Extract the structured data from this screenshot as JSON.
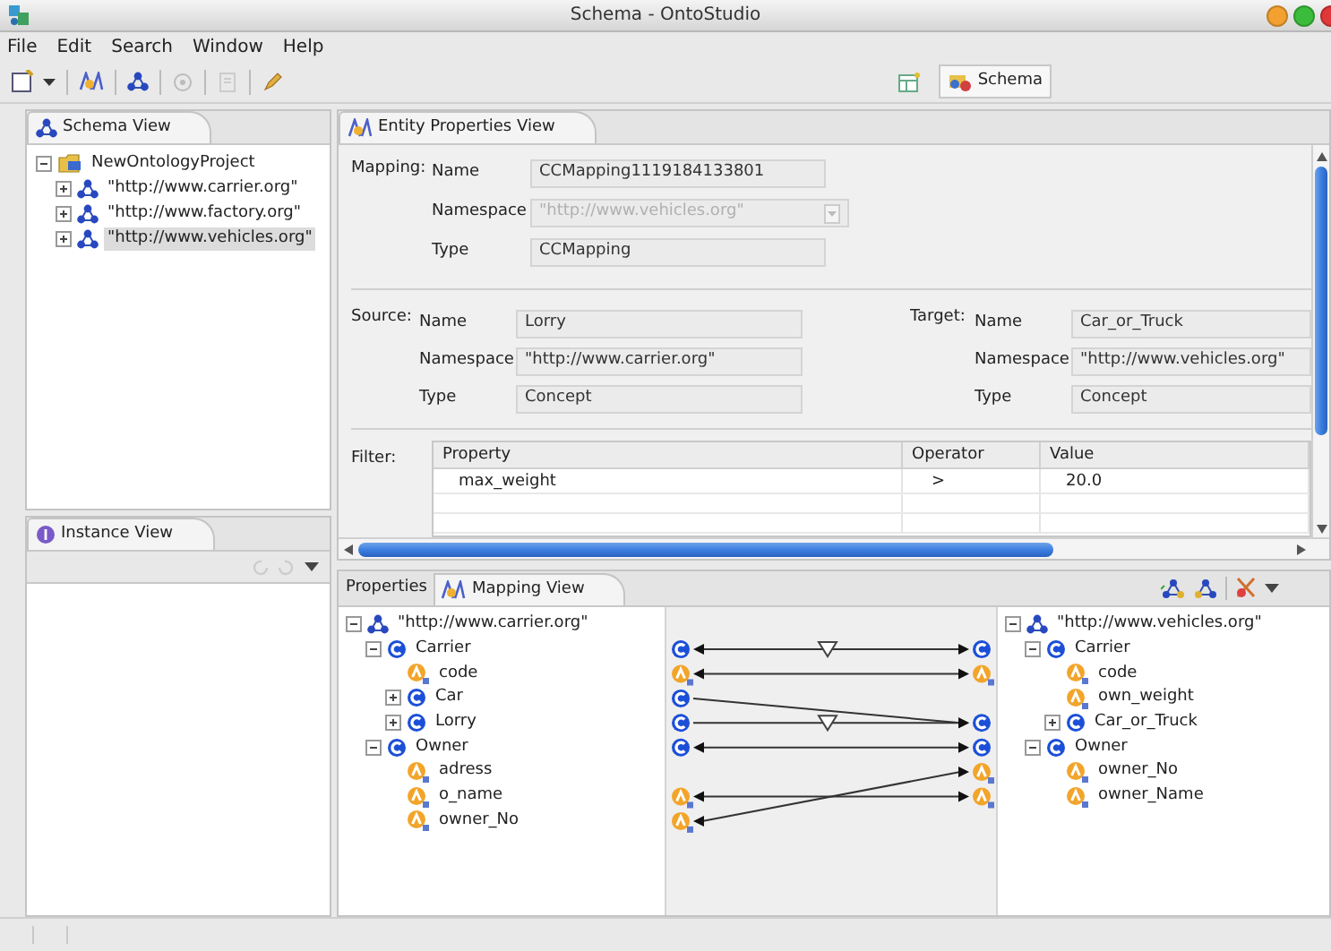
{
  "window": {
    "title": "Schema - OntoStudio"
  },
  "menu": [
    "File",
    "Edit",
    "Search",
    "Window",
    "Help"
  ],
  "perspectives": [
    {
      "label": "Schema",
      "selected": true
    }
  ],
  "schema_view": {
    "title": "Schema View",
    "tree": [
      {
        "label": "NewOntologyProject",
        "kind": "project",
        "expanded": true,
        "selected": false,
        "children": [
          {
            "label": "\"http://www.carrier.org\"",
            "kind": "namespace",
            "expanded": false,
            "selected": false
          },
          {
            "label": "\"http://www.factory.org\"",
            "kind": "namespace",
            "expanded": false,
            "selected": false
          },
          {
            "label": "\"http://www.vehicles.org\"",
            "kind": "namespace",
            "expanded": false,
            "selected": true
          }
        ]
      }
    ]
  },
  "instance_view": {
    "title": "Instance View"
  },
  "entity_properties": {
    "title": "Entity Properties View",
    "mapping": {
      "label": "Mapping:",
      "fields": [
        {
          "label": "Name",
          "value": "CCMapping1119184133801",
          "kind": "text",
          "disabled": false
        },
        {
          "label": "Namespace",
          "value": "\"http://www.vehicles.org\"",
          "kind": "combo",
          "disabled": true
        },
        {
          "label": "Type",
          "value": "CCMapping",
          "kind": "text",
          "disabled": false
        }
      ]
    },
    "source": {
      "label": "Source:",
      "fields": [
        {
          "label": "Name",
          "value": "Lorry"
        },
        {
          "label": "Namespace",
          "value": "\"http://www.carrier.org\""
        },
        {
          "label": "Type",
          "value": "Concept"
        }
      ]
    },
    "target": {
      "label": "Target:",
      "fields": [
        {
          "label": "Name",
          "value": "Car_or_Truck"
        },
        {
          "label": "Namespace",
          "value": "\"http://www.vehicles.org\""
        },
        {
          "label": "Type",
          "value": "Concept"
        }
      ]
    },
    "filter": {
      "label": "Filter:",
      "columns": [
        "Property",
        "Operator",
        "Value"
      ],
      "rows": [
        [
          "max_weight",
          ">",
          "20.0"
        ]
      ]
    }
  },
  "mapping_view": {
    "tabs": [
      {
        "label": "Properties",
        "selected": false
      },
      {
        "label": "Mapping View",
        "selected": true
      }
    ],
    "source_tree": [
      {
        "label": "\"http://www.carrier.org\"",
        "kind": "namespace",
        "expanded": true,
        "children": [
          {
            "label": "Carrier",
            "kind": "concept",
            "expanded": true,
            "children": [
              {
                "label": "code",
                "kind": "attribute"
              },
              {
                "label": "Car",
                "kind": "concept",
                "expanded": false
              },
              {
                "label": "Lorry",
                "kind": "concept",
                "expanded": false
              }
            ]
          },
          {
            "label": "Owner",
            "kind": "concept",
            "expanded": true,
            "children": [
              {
                "label": "adress",
                "kind": "attribute"
              },
              {
                "label": "o_name",
                "kind": "attribute"
              },
              {
                "label": "owner_No",
                "kind": "attribute"
              }
            ]
          }
        ]
      }
    ],
    "target_tree": [
      {
        "label": "\"http://www.vehicles.org\"",
        "kind": "namespace",
        "expanded": true,
        "children": [
          {
            "label": "Carrier",
            "kind": "concept",
            "expanded": true,
            "children": [
              {
                "label": "code",
                "kind": "attribute"
              },
              {
                "label": "own_weight",
                "kind": "attribute"
              },
              {
                "label": "Car_or_Truck",
                "kind": "concept",
                "expanded": false
              }
            ]
          },
          {
            "label": "Owner",
            "kind": "concept",
            "expanded": true,
            "children": [
              {
                "label": "owner_No",
                "kind": "attribute"
              },
              {
                "label": "owner_Name",
                "kind": "attribute"
              }
            ]
          }
        ]
      }
    ],
    "mappings": [
      {
        "kind": "bidirectional",
        "filter": true
      },
      {
        "kind": "bidirectional",
        "filter": false
      },
      {
        "kind": "directed",
        "filter": false
      },
      {
        "kind": "directed",
        "filter": true
      },
      {
        "kind": "bidirectional",
        "filter": false
      },
      {
        "kind": "bidirectional",
        "filter": false
      },
      {
        "kind": "bidirectional",
        "filter": false
      }
    ]
  }
}
